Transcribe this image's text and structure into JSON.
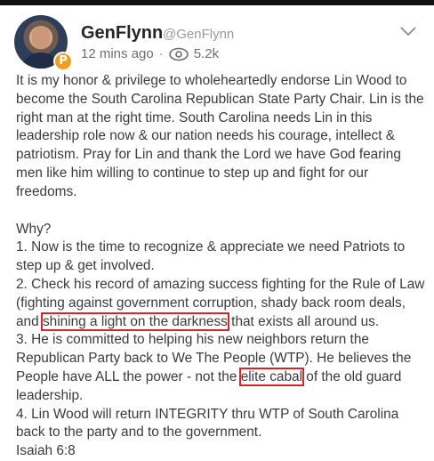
{
  "post": {
    "author_name": "GenFlynn",
    "handle": "@GenFlynn",
    "time": "12 mins ago",
    "separator": "·",
    "views": "5.2k",
    "para1": "It is my honor & privilege to wholeheartedly endorse Lin Wood to become the South Carolina Republican State Party Chair. Lin is the right man at the right time. South Carolina needs Lin in this leadership role now & our nation needs his courage, intellect & patriotism. Pray for Lin and thank the Lord we have God fearing men like him willing to continue to step up and fight for our freedoms.",
    "why": "Why?",
    "point1": "1. Now is the time to recognize & appreciate we need Patriots to step up & get involved.",
    "point2_before": "2. Check his record of amazing success fighting for the Rule of Law (fighting against government corruption, shady back room deals, and ",
    "point2_highlight": "shining a light on the darkness",
    "point2_after": " that exists all around us.",
    "point3_before": "3. He is committed to helping his new neighbors return the Republican Party back to We The People (WTP). He believes the People have ALL the power - not the ",
    "point3_highlight": "elite cabal",
    "point3_after": " of the old guard leadership.",
    "point4": "4. Lin Wood will return INTEGRITY thru WTP of South Carolina back to the party and to the government.",
    "footer": "Isaiah 6:8"
  },
  "badge": {
    "letter": "P",
    "color": "#f0a020"
  },
  "colors": {
    "highlight_box": "#d8232a"
  },
  "icons": {
    "views": "eye-icon",
    "menu": "chevron-down-icon"
  }
}
